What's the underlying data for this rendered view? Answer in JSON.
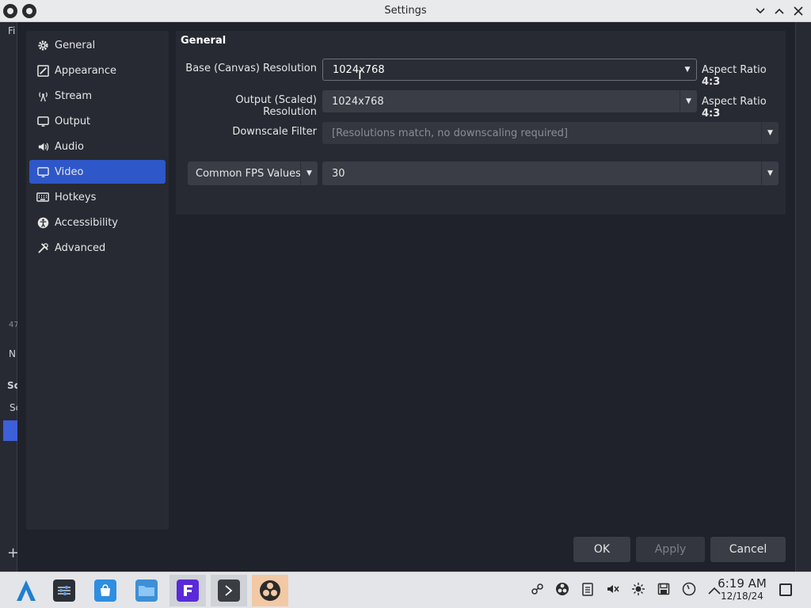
{
  "window": {
    "title": "Settings"
  },
  "background_window": {
    "label_f": "Fi",
    "label_47": "47",
    "label_n": "N",
    "label_sc": "Sc",
    "label_sc2": "Sc",
    "plus": "+"
  },
  "sidebar": {
    "items": [
      {
        "label": "General",
        "icon": "gear-icon"
      },
      {
        "label": "Appearance",
        "icon": "appearance-icon"
      },
      {
        "label": "Stream",
        "icon": "antenna-icon"
      },
      {
        "label": "Output",
        "icon": "output-icon"
      },
      {
        "label": "Audio",
        "icon": "speaker-icon"
      },
      {
        "label": "Video",
        "icon": "monitor-icon",
        "active": true
      },
      {
        "label": "Hotkeys",
        "icon": "keyboard-icon"
      },
      {
        "label": "Accessibility",
        "icon": "accessibility-icon"
      },
      {
        "label": "Advanced",
        "icon": "tools-icon"
      }
    ]
  },
  "panel": {
    "title": "General",
    "base_label": "Base (Canvas) Resolution",
    "base_value": "1024x768",
    "base_aspect_prefix": "Aspect Ratio",
    "base_aspect_value": "4:3",
    "output_label": "Output (Scaled) Resolution",
    "output_value": "1024x768",
    "output_aspect_prefix": "Aspect Ratio",
    "output_aspect_value": "4:3",
    "downscale_label": "Downscale Filter",
    "downscale_value": "[Resolutions match, no downscaling required]",
    "fps_type": "Common FPS Values",
    "fps_value": "30"
  },
  "buttons": {
    "ok": "OK",
    "apply": "Apply",
    "cancel": "Cancel"
  },
  "taskbar": {
    "apps": [
      "launcher-icon",
      "settings-app-icon",
      "discover-icon",
      "files-icon",
      "font-app-icon",
      "terminal-icon",
      "obs-icon"
    ],
    "clock_time": "6:19 AM",
    "clock_date": "12/18/24"
  },
  "colors": {
    "accent": "#2e57c9",
    "dialog_bg": "#1f222a",
    "panel_bg": "#272a33",
    "control_bg": "#3a3d46"
  }
}
